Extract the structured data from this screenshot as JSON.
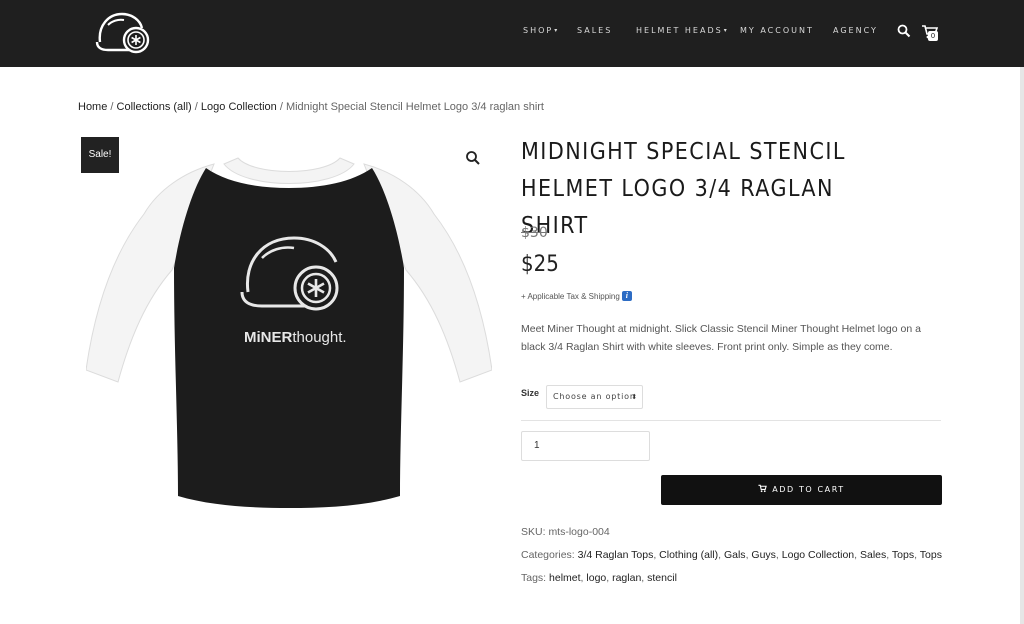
{
  "header": {
    "nav": [
      {
        "label": "SHOP",
        "has_dropdown": true
      },
      {
        "label": "SALES",
        "has_dropdown": false
      },
      {
        "label": "HELMET HEADS",
        "has_dropdown": true
      },
      {
        "label": "MY ACCOUNT",
        "has_dropdown": false
      },
      {
        "label": "AGENCY",
        "has_dropdown": false
      }
    ],
    "cart_count": "0",
    "icons": [
      "helmet-logo-icon",
      "search-icon",
      "cart-icon"
    ]
  },
  "breadcrumb": {
    "items": [
      "Home",
      "Collections (all)",
      "Logo Collection"
    ],
    "current": "Midnight Special Stencil Helmet Logo 3/4 raglan shirt",
    "separator": "/"
  },
  "product": {
    "sale_badge": "Sale!",
    "title_line1": "Midnight Special Stencil",
    "title_line2": "Helmet Logo 3/4 Raglan Shirt",
    "old_price": "$30",
    "price": "$25",
    "tax_note": "+ Applicable Tax & Shipping",
    "description": "Meet Miner Thought at midnight. Slick Classic Stencil Miner Thought Helmet logo on a black 3/4 Raglan Shirt with white sleeves. Front print only. Simple as they come.",
    "size_label": "Size",
    "size_select": "Choose an option",
    "quantity": "1",
    "add_to_cart": "ADD TO CART",
    "shirt_print_bold": "MiNER",
    "shirt_print_light": "thought.",
    "sku_label": "SKU:",
    "sku": "mts-logo-004",
    "categories_label": "Categories:",
    "categories": [
      "3/4 Raglan Tops",
      "Clothing (all)",
      "Gals",
      "Guys",
      "Logo Collection",
      "Sales",
      "Tops",
      "Tops"
    ],
    "tags_label": "Tags:",
    "tags": [
      "helmet",
      "logo",
      "raglan",
      "stencil"
    ]
  },
  "colors": {
    "header_bg": "#1f1f1f",
    "button_bg": "#111111",
    "info_blue": "#2d6cc4"
  }
}
